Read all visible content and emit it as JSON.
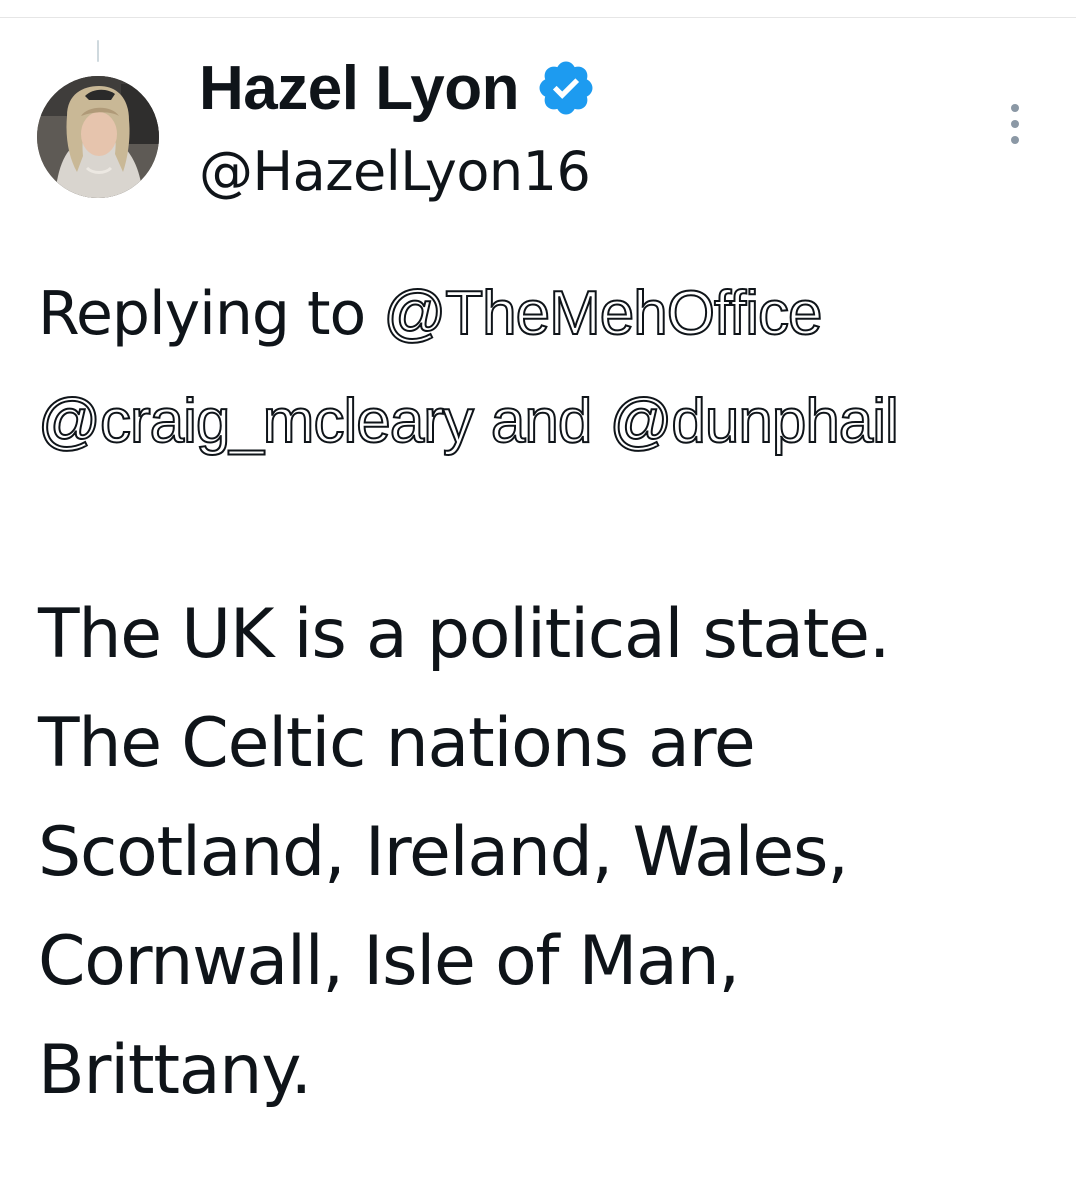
{
  "tweet": {
    "author": {
      "display_name": "Hazel Lyon",
      "handle": "@HazelLyon16",
      "verified": true,
      "verified_icon": "verified-badge-icon",
      "avatar_icon": "profile-photo"
    },
    "reply_context": {
      "prefix": "Replying to",
      "mentions": [
        "@TheMehOffice",
        "@craig_mcleary",
        "@dunphail"
      ],
      "conjunction": "and"
    },
    "text_lines": [
      "The UK is a political state.",
      "The Celtic nations are",
      "Scotland, Ireland, Wales,",
      "Cornwall, Isle of Man,",
      "Brittany."
    ],
    "more_icon": "more-options-icon"
  },
  "colors": {
    "text": "#0f1419",
    "verified_blue": "#1d9bf0",
    "muted_icon": "#8b98a5",
    "divider": "#e6e6e6"
  }
}
